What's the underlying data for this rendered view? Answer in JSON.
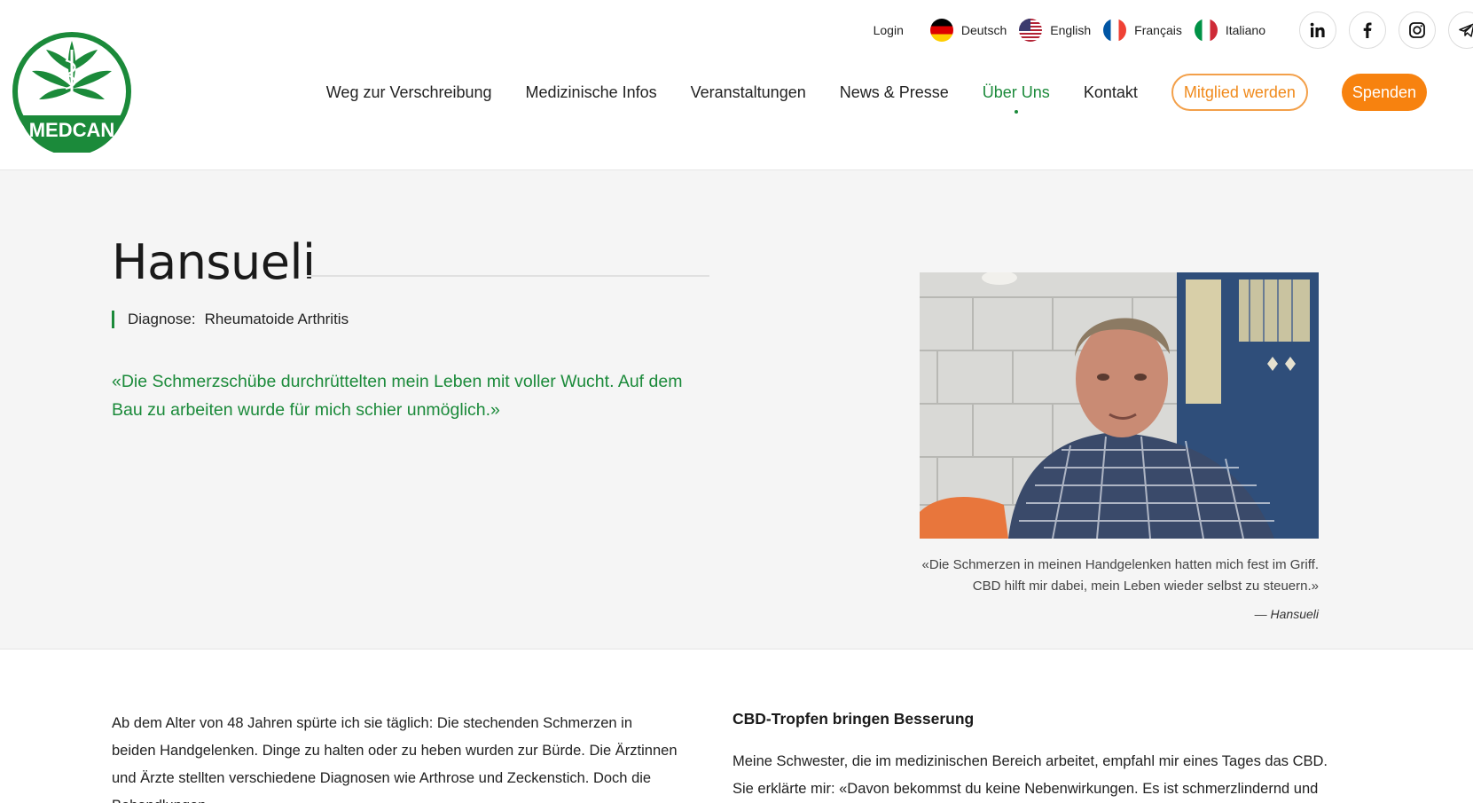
{
  "header": {
    "logo_text": "MEDCAN",
    "login": "Login",
    "languages": [
      {
        "label": "Deutsch"
      },
      {
        "label": "English"
      },
      {
        "label": "Français"
      },
      {
        "label": "Italiano"
      }
    ],
    "nav": [
      {
        "label": "Weg zur Verschreibung"
      },
      {
        "label": "Medizinische Infos"
      },
      {
        "label": "Veranstaltungen"
      },
      {
        "label": "News & Presse"
      },
      {
        "label": "Über Uns"
      },
      {
        "label": "Kontakt"
      }
    ],
    "member_button": "Mitglied werden",
    "donate_button": "Spenden",
    "colors": {
      "brand_green": "#1b8a3a",
      "accent_orange": "#f7820f"
    }
  },
  "hero": {
    "title": "Hansueli",
    "diagnosis_label": "Diagnose:",
    "diagnosis_value": "Rheumatoide Arthritis",
    "pull_quote": "«Die Schmerzschübe durchrüttelten mein Leben mit voller Wucht. Auf dem Bau zu arbeiten wurde für mich schier unmöglich.»",
    "caption_line1": "«Die Schmerzen in meinen Handgelenken hatten mich fest im Griff.",
    "caption_line2": "CBD hilft mir dabei, mein Leben wieder selbst zu steuern.»",
    "caption_author": "— Hansueli"
  },
  "body": {
    "left_text": "Ab dem Alter von 48 Jahren spürte ich sie täglich: Die stechenden Schmerzen in beiden Handgelenken. Dinge zu halten oder zu heben wurden zur Bürde. Die Ärztinnen und Ärzte stellten verschiedene Diagnosen wie Arthrose und Zeckenstich. Doch die Behandlungen",
    "right_heading": "CBD-Tropfen bringen Besserung",
    "right_text": "Meine Schwester, die im medizinischen Bereich arbeitet, empfahl mir eines Tages das CBD. Sie erklärte mir: «Davon bekommst du keine Nebenwirkungen. Es ist schmerzlindernd und"
  }
}
